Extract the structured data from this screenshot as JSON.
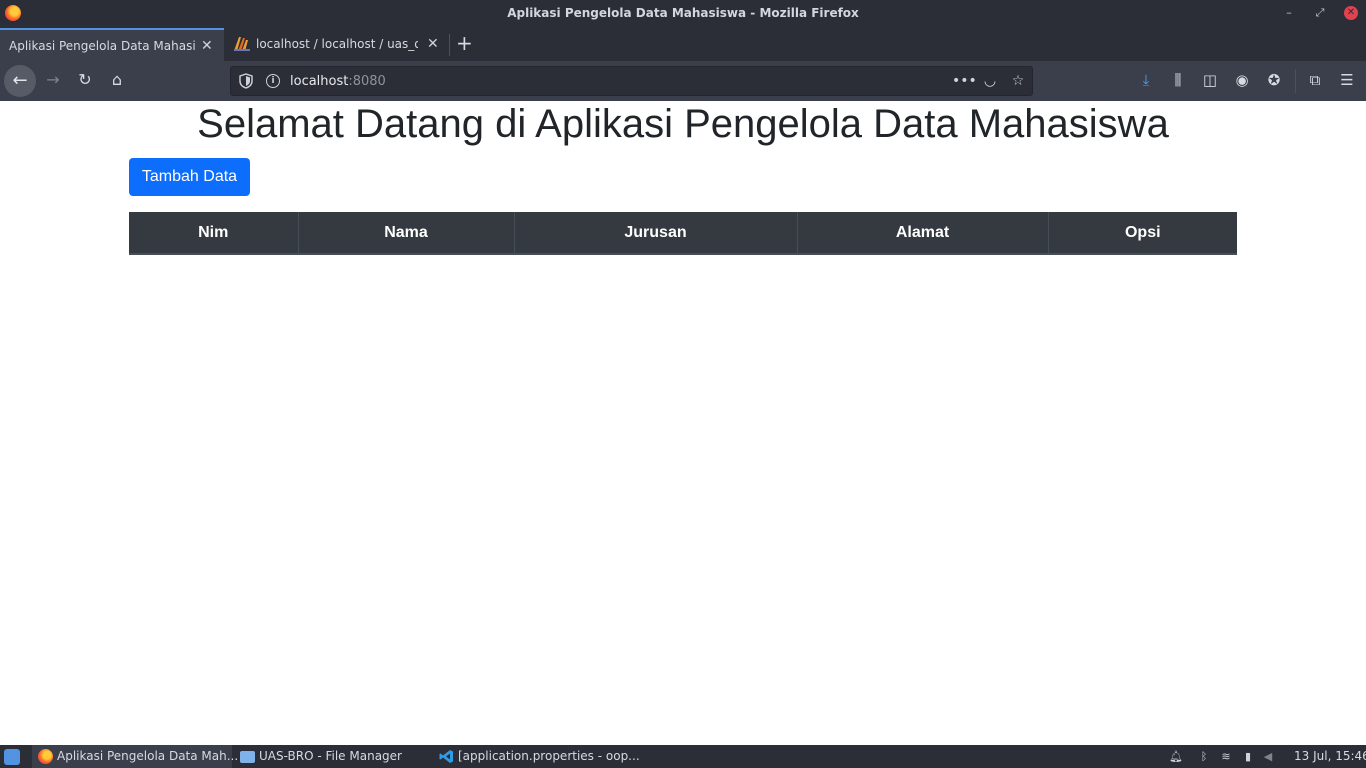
{
  "window": {
    "title": "Aplikasi Pengelola Data Mahasiswa - Mozilla Firefox"
  },
  "tabs": [
    {
      "label": "Aplikasi Pengelola Data Mahasiswa",
      "active": true
    },
    {
      "label": "localhost / localhost / uas_oop",
      "active": false
    }
  ],
  "navbar": {
    "url_host": "localhost",
    "url_port": ":8080"
  },
  "page": {
    "heading": "Selamat Datang di Aplikasi Pengelola Data Mahasiswa",
    "add_button": "Tambah Data",
    "table": {
      "headers": [
        "Nim",
        "Nama",
        "Jurusan",
        "Alamat",
        "Opsi"
      ],
      "rows": []
    }
  },
  "taskbar": {
    "tasks": [
      {
        "label": "Aplikasi Pengelola Data Mah...",
        "active": true
      },
      {
        "label": "UAS-BRO - File Manager",
        "active": false
      },
      {
        "label": "[application.properties - oop...",
        "active": false
      }
    ],
    "clock": "13 Jul, 15:46"
  },
  "colors": {
    "primary": "#0d6efd",
    "table_header_bg": "#343a40",
    "tab_accent": "#5294e2"
  }
}
